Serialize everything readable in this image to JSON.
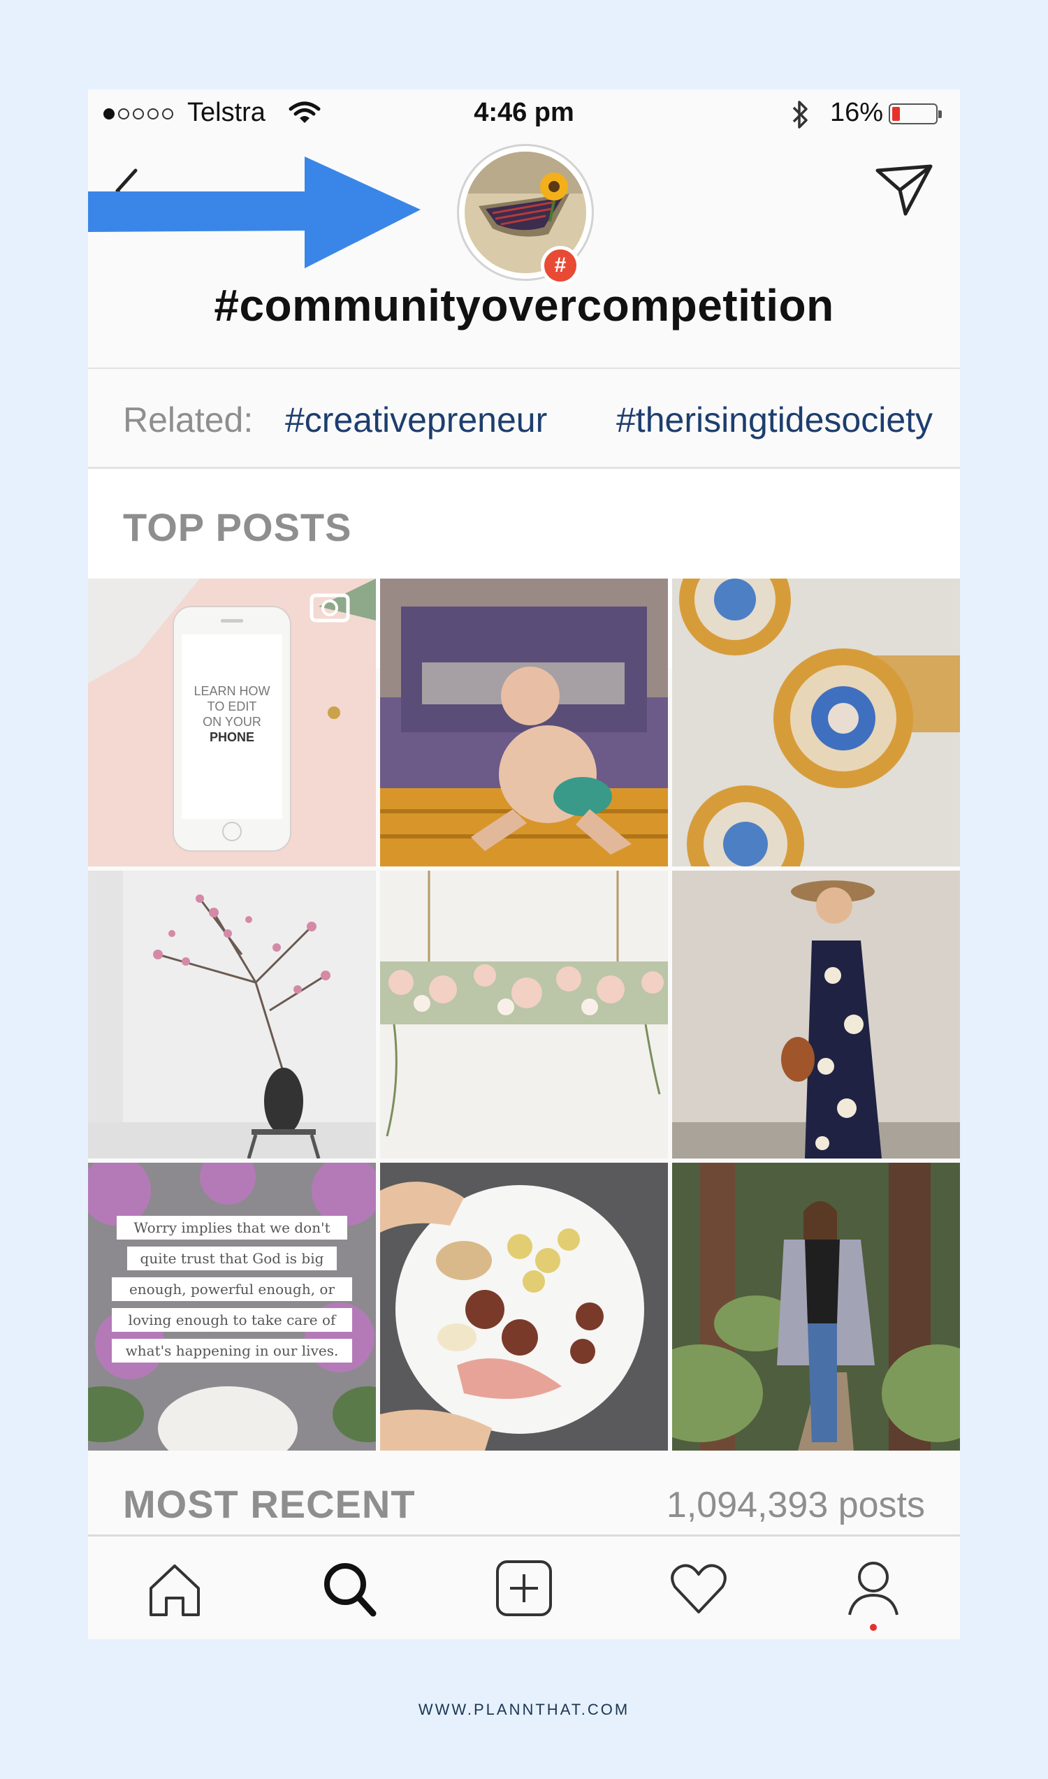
{
  "status_bar": {
    "carrier": "Telstra",
    "time": "4:46 pm",
    "battery_percent": "16%",
    "bluetooth_icon": "bluetooth-icon",
    "wifi_icon": "wifi-icon"
  },
  "header": {
    "hashtag": "#communityovercompetition",
    "badge": "#",
    "back_icon": "chevron-left-icon",
    "share_icon": "paper-plane-icon"
  },
  "related": {
    "label": "Related:",
    "tags": [
      "#creativepreneur",
      "#therisingtidesociety"
    ]
  },
  "top_posts": {
    "title": "TOP POSTS"
  },
  "posts": {
    "phone_text": [
      "LEARN HOW",
      "TO EDIT",
      "ON YOUR",
      "PHONE"
    ],
    "quote_lines": [
      "Worry implies that we don't",
      "quite trust that God is big",
      "enough, powerful enough, or",
      "loving enough to take care of",
      "what's happening in our lives."
    ]
  },
  "most_recent": {
    "title": "MOST RECENT",
    "count": "1,094,393 posts"
  },
  "tabbar": {
    "items": [
      "home-icon",
      "search-icon",
      "add-post-icon",
      "heart-icon",
      "profile-icon"
    ]
  },
  "colors": {
    "page_bg": "#e6f1fd",
    "arrow": "#3a86e8",
    "related_tag": "#1d3e6e",
    "badge": "#e94a35"
  },
  "footer": {
    "url": "WWW.PLANNTHAT.COM"
  }
}
